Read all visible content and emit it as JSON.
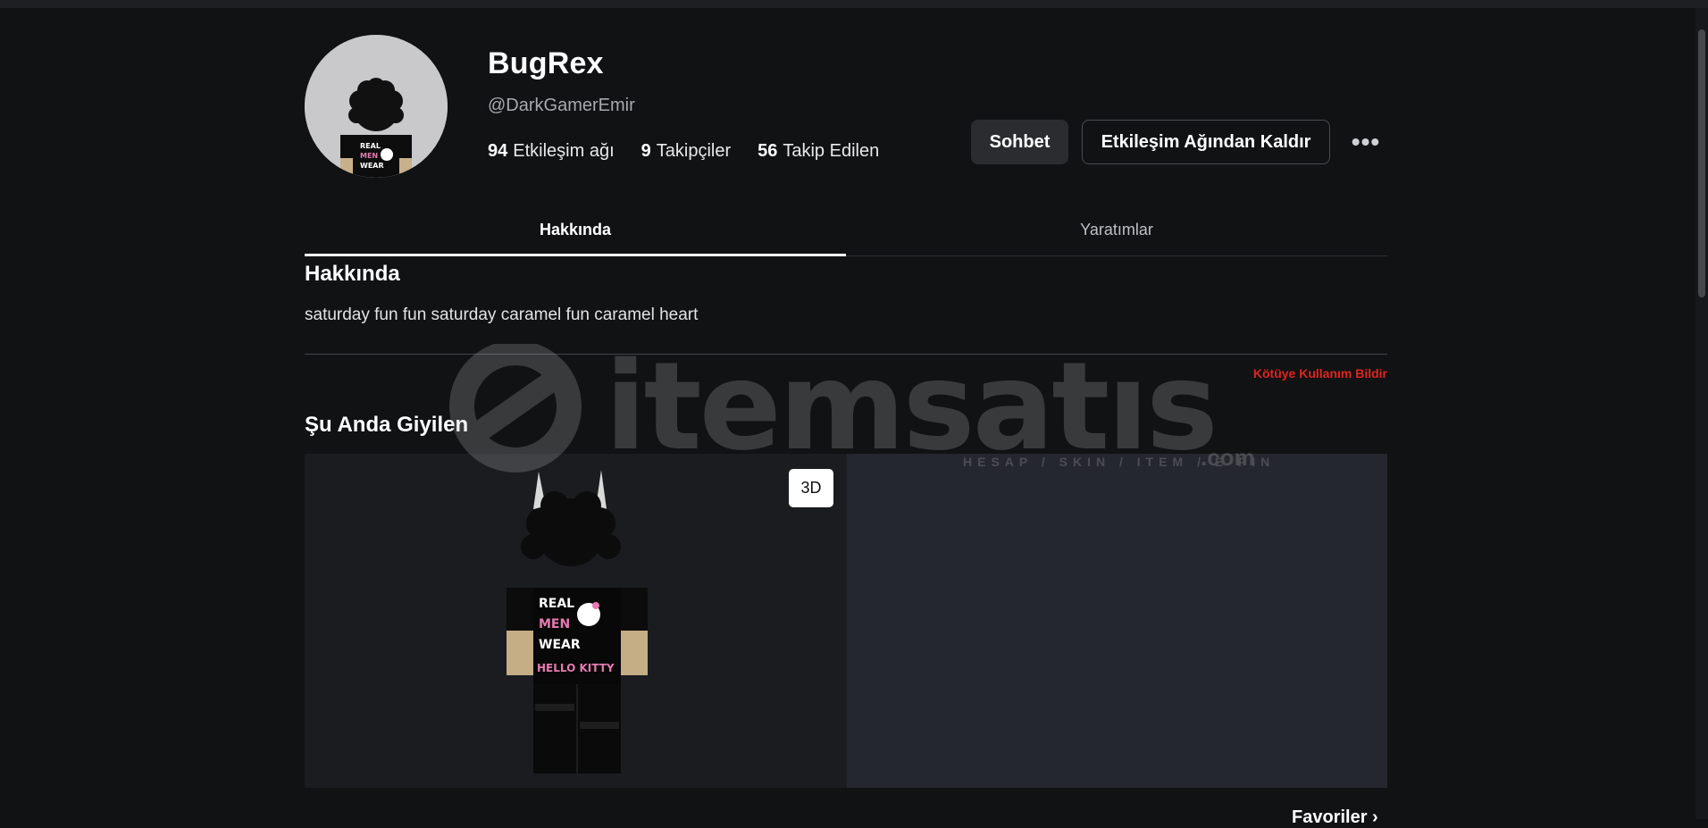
{
  "profile": {
    "display_name": "BugRex",
    "username": "@DarkGamerEmir",
    "stats": [
      {
        "count": "94",
        "label": "Etkileşim ağı"
      },
      {
        "count": "9",
        "label": "Takipçiler"
      },
      {
        "count": "56",
        "label": "Takip Edilen"
      }
    ]
  },
  "actions": {
    "chat_label": "Sohbet",
    "remove_label": "Etkileşim Ağından Kaldır",
    "more_label": "•••"
  },
  "tabs": [
    {
      "label": "Hakkında",
      "active": true
    },
    {
      "label": "Yaratımlar",
      "active": false
    }
  ],
  "about": {
    "title": "Hakkında",
    "bio": "saturday fun fun saturday caramel fun caramel heart",
    "report_label": "Kötüye Kullanım Bildir"
  },
  "wearing": {
    "title": "Şu Anda Giyilen",
    "view_3d_label": "3D",
    "shirt_text": [
      "REAL",
      "MEN",
      "WEAR",
      "HELLO KITTY"
    ]
  },
  "favorites": {
    "label": "Favoriler",
    "icon": "chevron-right-icon"
  },
  "watermark": {
    "brand": "itemsatıs",
    "tagline": "HESAP / SKIN / ITEM / E-PIN",
    "domain": ".com"
  },
  "colors": {
    "background": "#111214",
    "report_red": "#e1231e",
    "button_dark": "#2b2c30",
    "panel": "#25272e"
  }
}
